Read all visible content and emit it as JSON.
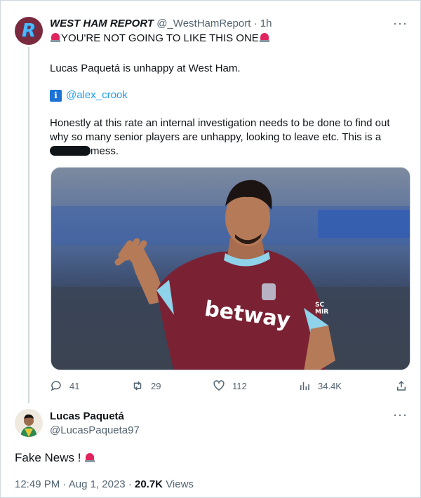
{
  "tweet": {
    "author_name": "WEST HAM REPORT",
    "handle": "@_WestHamReport",
    "separator": "·",
    "time_ago": "1h",
    "headline": "YOU'RE NOT GOING TO LIKE THIS ONE",
    "line2": "Lucas Paquetá is unhappy at West Ham.",
    "info_letter": "i",
    "mention": "@alex_crook",
    "body_text": "Honestly at this rate an internal investigation needs to be done to find out why so many senior players are unhappy, looking to leave etc. This is a",
    "body_tail": "mess.",
    "more": "···",
    "photo": {
      "sponsor_text": "betway",
      "sleeve_text_1": "SC",
      "sleeve_text_2": "MIR"
    },
    "stats": {
      "replies": "41",
      "retweets": "29",
      "likes": "112",
      "views": "34.4K"
    }
  },
  "reply": {
    "name": "Lucas Paquetá",
    "handle": "@LucasPaqueta97",
    "text": "Fake News !",
    "more": "···",
    "time": "12:49 PM",
    "date": "Aug 1, 2023",
    "views_count": "20.7K",
    "views_label": "Views",
    "separator": "·"
  },
  "icons": [
    "reply-icon",
    "retweet-icon",
    "like-icon",
    "views-icon",
    "share-icon",
    "siren-icon",
    "info-icon",
    "more-icon"
  ],
  "colors": {
    "link": "#1d9bf0",
    "secondary": "#536471",
    "siren": "#e0245e",
    "claret": "#7a2a3f"
  }
}
